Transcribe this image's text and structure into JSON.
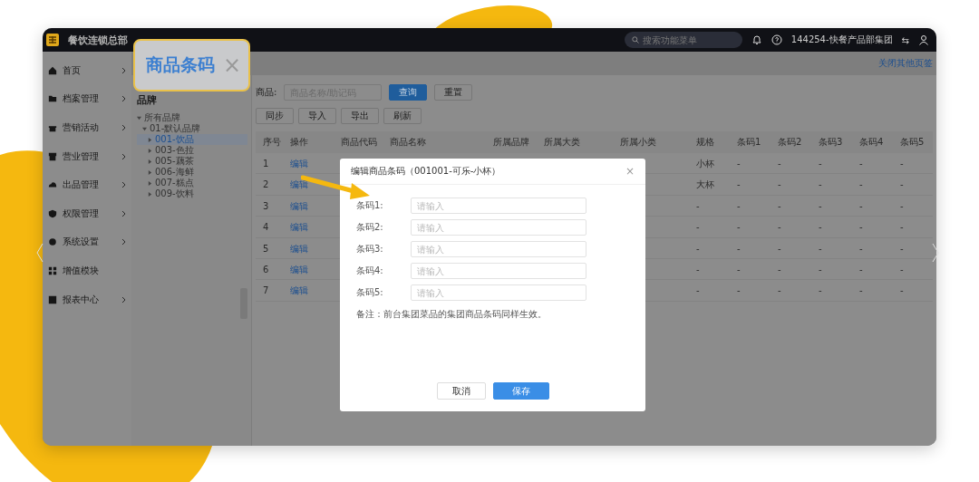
{
  "app": {
    "name": "餐饮连锁总部",
    "search": {
      "placeholder": "搜索功能菜单"
    },
    "account": "144254-快餐产品部集团",
    "switch_glyph": "⇆"
  },
  "sidebar": {
    "items": [
      {
        "label": "首页",
        "has_children": true
      },
      {
        "label": "档案管理",
        "has_children": true
      },
      {
        "label": "营销活动",
        "has_children": true
      },
      {
        "label": "营业管理",
        "has_children": true
      },
      {
        "label": "出品管理",
        "has_children": true
      },
      {
        "label": "权限管理",
        "has_children": true
      },
      {
        "label": "系统设置",
        "has_children": true
      },
      {
        "label": "增值模块",
        "has_children": false
      },
      {
        "label": "报表中心",
        "has_children": true
      }
    ]
  },
  "tabs_bar": {
    "close_others": "关闭其他页签"
  },
  "callout": {
    "label": "商品条码",
    "close": "×"
  },
  "tree": {
    "title": "品牌",
    "items": [
      {
        "label": "所有品牌",
        "expanded": true,
        "selected": false,
        "children": [
          {
            "label": "01-默认品牌",
            "expanded": true,
            "selected": false,
            "children": [
              {
                "label": "001-饮品",
                "expanded": false,
                "selected": true
              },
              {
                "label": "003-色拉",
                "expanded": false,
                "selected": false
              },
              {
                "label": "005-藕茶",
                "expanded": false,
                "selected": false
              },
              {
                "label": "006-海鲜",
                "expanded": false,
                "selected": false
              },
              {
                "label": "007-糕点",
                "expanded": false,
                "selected": false
              },
              {
                "label": "009-饮料",
                "expanded": false,
                "selected": false
              }
            ]
          }
        ]
      }
    ]
  },
  "filter": {
    "label": "商品:",
    "placeholder": "商品名称/助记码",
    "buttons": [
      {
        "label": "查询",
        "kind": "primary"
      },
      {
        "label": "重置",
        "kind": "default"
      }
    ]
  },
  "toolbar": [
    "同步",
    "导入",
    "导出",
    "刷新"
  ],
  "table": {
    "columns": [
      "序号",
      "操作",
      "商品代码",
      "商品名称",
      "所属品牌",
      "所属大类",
      "所属小类",
      "规格",
      "条码1",
      "条码2",
      "条码3",
      "条码4",
      "条码5"
    ],
    "rows": [
      {
        "no": "1",
        "action": "编辑",
        "spec": "小杯",
        "codes": [
          "-",
          "-",
          "-",
          "-",
          "-"
        ]
      },
      {
        "no": "2",
        "action": "编辑",
        "spec": "大杯",
        "codes": [
          "-",
          "-",
          "-",
          "-",
          "-"
        ]
      },
      {
        "no": "3",
        "action": "编辑",
        "spec": "-",
        "codes": [
          "-",
          "-",
          "-",
          "-",
          "-"
        ]
      },
      {
        "no": "4",
        "action": "编辑",
        "spec": "-",
        "codes": [
          "-",
          "-",
          "-",
          "-",
          "-"
        ]
      },
      {
        "no": "5",
        "action": "编辑",
        "spec": "-",
        "codes": [
          "-",
          "-",
          "-",
          "-",
          "-"
        ]
      },
      {
        "no": "6",
        "action": "编辑",
        "spec": "-",
        "codes": [
          "-",
          "-",
          "-",
          "-",
          "-"
        ]
      },
      {
        "no": "7",
        "action": "编辑",
        "spec": "-",
        "codes": [
          "-",
          "-",
          "-",
          "-",
          "-"
        ]
      }
    ]
  },
  "dialog": {
    "title": "编辑商品条码（001001-可乐-小杯）",
    "close": "×",
    "fields": [
      {
        "label": "条码1:",
        "placeholder": "请输入"
      },
      {
        "label": "条码2:",
        "placeholder": "请输入"
      },
      {
        "label": "条码3:",
        "placeholder": "请输入"
      },
      {
        "label": "条码4:",
        "placeholder": "请输入"
      },
      {
        "label": "条码5:",
        "placeholder": "请输入"
      }
    ],
    "note": "备注：前台集团菜品的集团商品条码同样生效。",
    "buttons": [
      {
        "label": "取消",
        "kind": "default"
      },
      {
        "label": "保存",
        "kind": "primary"
      }
    ]
  }
}
